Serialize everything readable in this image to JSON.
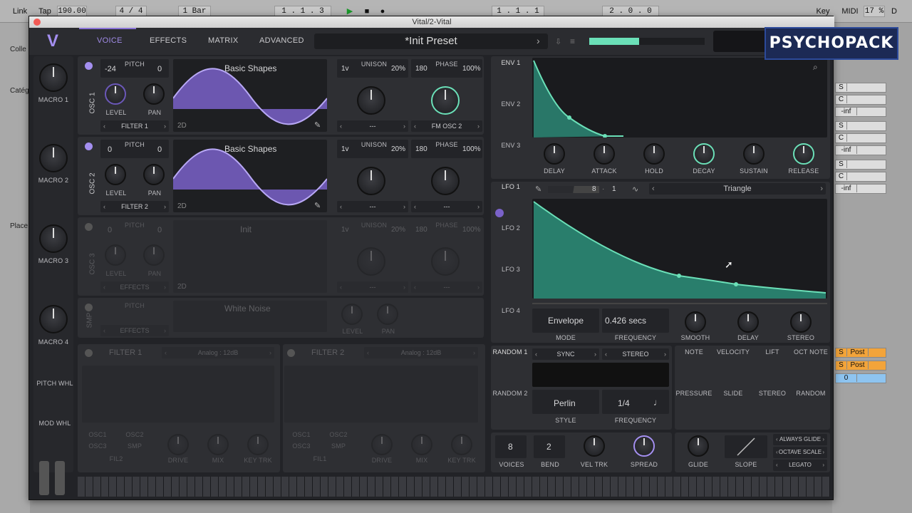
{
  "host": {
    "link": "Link",
    "tap": "Tap",
    "tempo": "190.00",
    "meter": "4 / 4",
    "quant": "1 Bar",
    "pos1": "1 .   1 .   3",
    "pos2": "1 .   1 .   1",
    "pos3": "2 .   0 .   0",
    "key": "Key",
    "midi": "MIDI",
    "cpu": "17 %",
    "disk": "D",
    "side": [
      "Colle",
      "Catég",
      "Place"
    ],
    "tracks": [
      "S",
      "C",
      "-inf",
      "S",
      "C",
      "-inf",
      "S",
      "C",
      "-inf",
      "S",
      "S",
      "0"
    ],
    "post": "Post"
  },
  "window": {
    "title": "Vital/2-Vital"
  },
  "header": {
    "tabs": [
      "VOICE",
      "EFFECTS",
      "MATRIX",
      "ADVANCED"
    ],
    "preset": "*Init Preset"
  },
  "badge": "PSYCHOPACK",
  "macros": [
    "MACRO 1",
    "MACRO 2",
    "MACRO 3",
    "MACRO 4"
  ],
  "wheels": {
    "pitch": "PITCH WHL",
    "mod": "MOD WHL"
  },
  "osc": [
    {
      "label": "OSC 1",
      "pitch_l": "-24",
      "pitch_r": "0",
      "wave": "Basic Shapes",
      "dim": "2D",
      "level": "LEVEL",
      "pan": "PAN",
      "dest": "FILTER 1",
      "unison_v": "1v",
      "unison_p": "20%",
      "phase": "180",
      "phase_p": "100%",
      "mode": "---",
      "fm": "FM OSC 2"
    },
    {
      "label": "OSC 2",
      "pitch_l": "0",
      "pitch_r": "0",
      "wave": "Basic Shapes",
      "dim": "2D",
      "level": "LEVEL",
      "pan": "PAN",
      "dest": "FILTER 2",
      "unison_v": "1v",
      "unison_p": "20%",
      "phase": "180",
      "phase_p": "100%",
      "mode": "---",
      "fm": "---"
    },
    {
      "label": "OSC 3",
      "pitch_l": "0",
      "pitch_r": "0",
      "wave": "Init",
      "dim": "2D",
      "level": "LEVEL",
      "pan": "PAN",
      "dest": "EFFECTS",
      "unison_v": "1v",
      "unison_p": "20%",
      "phase": "180",
      "phase_p": "100%",
      "mode": "---",
      "fm": "---"
    }
  ],
  "common": {
    "pitch": "PITCH",
    "unison": "UNISON",
    "phase": "PHASE"
  },
  "smp": {
    "label": "SMP",
    "pitch": "PITCH",
    "wave": "White Noise",
    "dest": "EFFECTS",
    "level": "LEVEL",
    "pan": "PAN"
  },
  "filters": [
    {
      "name": "FILTER 1",
      "type": "Analog : 12dB",
      "src": [
        "OSC1",
        "OSC2",
        "OSC3",
        "SMP"
      ],
      "fil": "FIL2",
      "drive": "DRIVE",
      "mix": "MIX",
      "keytrk": "KEY TRK"
    },
    {
      "name": "FILTER 2",
      "type": "Analog : 12dB",
      "src": [
        "OSC1",
        "OSC2",
        "OSC3",
        "SMP"
      ],
      "fil": "FIL1",
      "drive": "DRIVE",
      "mix": "MIX",
      "keytrk": "KEY TRK"
    }
  ],
  "env": {
    "tabs": [
      "ENV 1",
      "ENV 2",
      "ENV 3"
    ],
    "knobs": [
      "DELAY",
      "ATTACK",
      "HOLD",
      "DECAY",
      "SUSTAIN",
      "RELEASE"
    ]
  },
  "lfo": {
    "tabs": [
      "LFO 1",
      "LFO 2",
      "LFO 3",
      "LFO 4"
    ],
    "grid_l": "8",
    "grid_r": "1",
    "shape": "Triangle",
    "mode": "Envelope",
    "freq": "0.426 secs",
    "labels": [
      "MODE",
      "FREQUENCY",
      "SMOOTH",
      "DELAY",
      "STEREO"
    ]
  },
  "random": {
    "tabs": [
      "RANDOM 1",
      "RANDOM 2"
    ],
    "sync": "SYNC",
    "stereo": "STEREO",
    "style": "Perlin",
    "freq": "1/4",
    "style_lbl": "STYLE",
    "freq_lbl": "FREQUENCY"
  },
  "mods": [
    "NOTE",
    "VELOCITY",
    "LIFT",
    "OCT NOTE",
    "PRESSURE",
    "SLIDE",
    "STEREO",
    "RANDOM"
  ],
  "voice": {
    "voices": "8",
    "bend": "2",
    "labels": [
      "VOICES",
      "BEND",
      "VEL TRK",
      "SPREAD",
      "GLIDE",
      "SLOPE"
    ],
    "opts": [
      "ALWAYS GLIDE",
      "OCTAVE SCALE",
      "LEGATO"
    ]
  }
}
